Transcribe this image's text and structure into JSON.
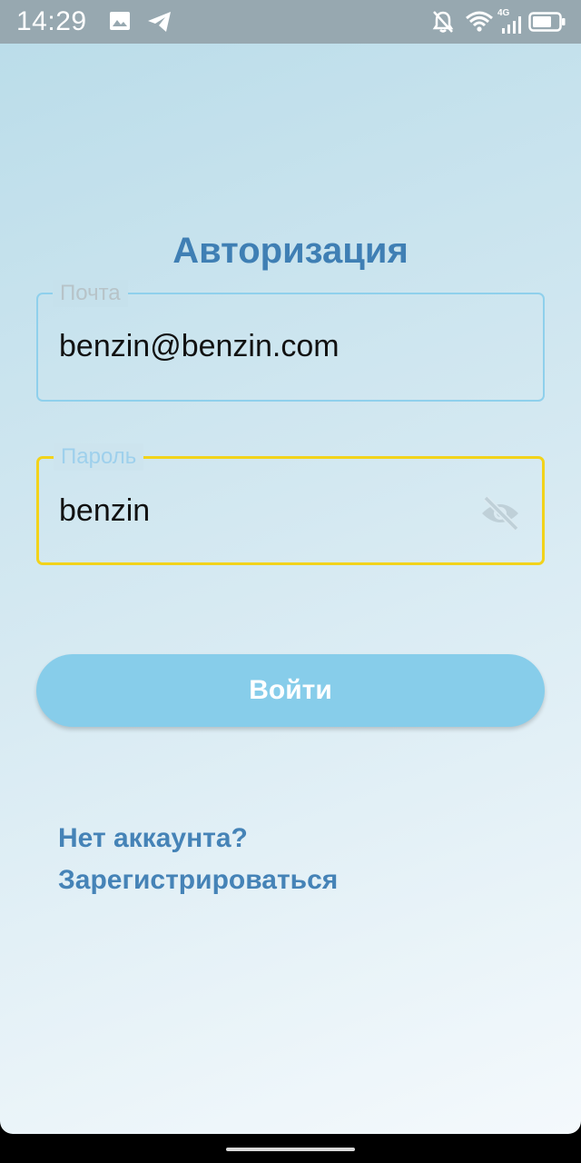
{
  "status_bar": {
    "time": "14:29",
    "network_label": "4G",
    "icons": [
      "image-icon",
      "telegram-icon",
      "bell-off-icon",
      "wifi-icon",
      "signal-icon",
      "battery-icon"
    ]
  },
  "page": {
    "title": "Авторизация"
  },
  "form": {
    "email": {
      "label": "Почта",
      "value": "benzin@benzin.com"
    },
    "password": {
      "label": "Пароль",
      "value": "benzin",
      "visibility_icon": "eye-off-icon"
    },
    "submit_label": "Войти"
  },
  "register": {
    "label": "Нет аккаунта?\nЗарегистрироваться"
  },
  "colors": {
    "title": "#3f7fb4",
    "button_bg": "#87cdea",
    "focused_border": "#f2d31b",
    "field_border": "#8fd0ec",
    "link": "#4583b7"
  }
}
